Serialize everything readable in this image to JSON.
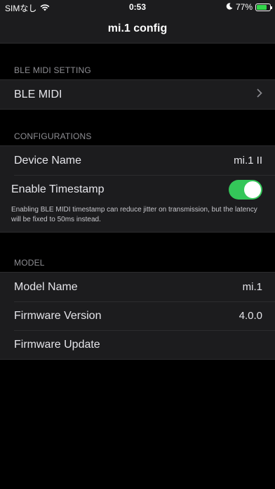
{
  "status_bar": {
    "carrier": "SIMなし",
    "time": "0:53",
    "battery_percent": "77%",
    "battery_level": 0.77,
    "icons": [
      "wifi-icon",
      "moon-icon",
      "battery-icon"
    ]
  },
  "nav": {
    "title": "mi.1 config"
  },
  "ble_section": {
    "header": "BLE MIDI SETTING",
    "rows": [
      {
        "label": "BLE MIDI",
        "accessory": "chevron-right-icon"
      }
    ]
  },
  "config_section": {
    "header": "CONFIGURATIONS",
    "device_name": {
      "label": "Device Name",
      "value": "mi.1 II"
    },
    "timestamp": {
      "label": "Enable Timestamp",
      "enabled": true
    },
    "note": "Enabling BLE MIDI timestamp can reduce jitter on transmission, but the latency will be fixed to 50ms instead."
  },
  "model_section": {
    "header": "MODEL",
    "model_name": {
      "label": "Model Name",
      "value": "mi.1"
    },
    "firmware_version": {
      "label": "Firmware Version",
      "value": "4.0.0"
    },
    "firmware_update": {
      "label": "Firmware Update"
    }
  },
  "colors": {
    "background": "#000000",
    "cell": "#1c1c1e",
    "toggle_on": "#34c759",
    "secondary_text": "#8e8e93"
  }
}
